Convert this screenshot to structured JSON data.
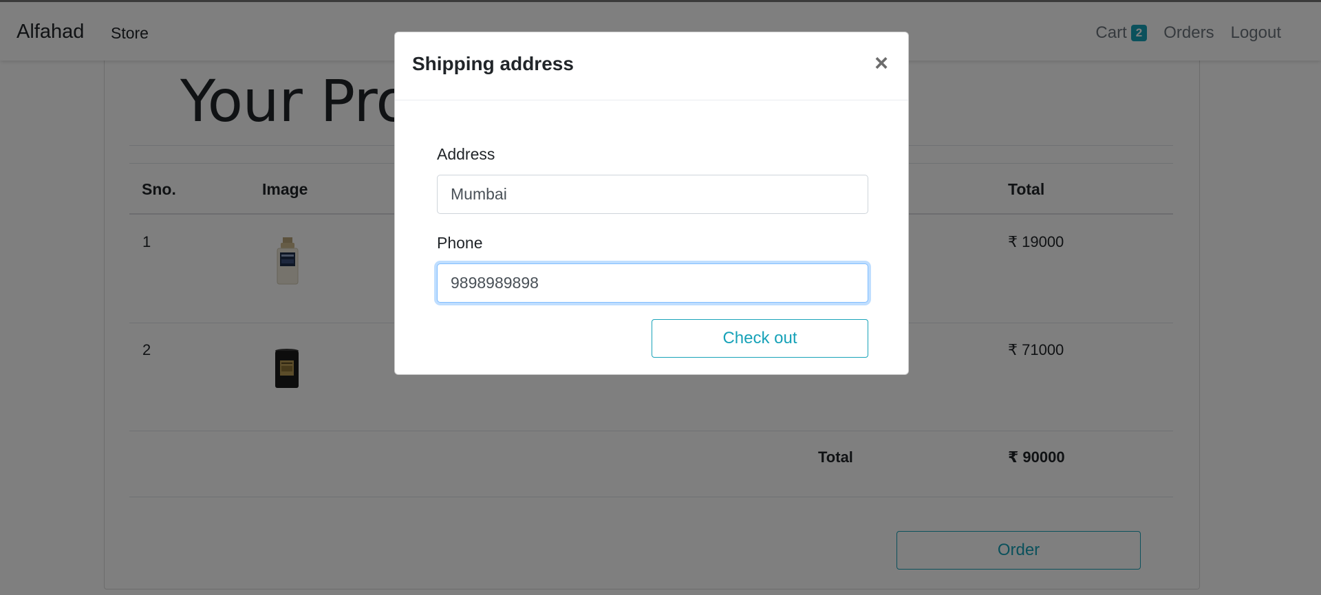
{
  "navbar": {
    "brand": "Alfahad",
    "store_label": "Store",
    "cart_label": "Cart",
    "cart_count": "2",
    "orders_label": "Orders",
    "logout_label": "Logout"
  },
  "page": {
    "title": "Your Products",
    "table": {
      "headers": [
        "Sno.",
        "Image",
        "Total"
      ],
      "rows": [
        {
          "sno": "1",
          "image": "perfume-bottle",
          "total": "₹ 19000"
        },
        {
          "sno": "2",
          "image": "candle-jar",
          "total": "₹ 71000"
        }
      ],
      "footer_label": "Total",
      "footer_total": "₹ 90000"
    },
    "order_label": "Order"
  },
  "modal": {
    "title": "Shipping address",
    "close_icon": "close-icon",
    "address_label": "Address",
    "address_value": "Mumbai",
    "phone_label": "Phone",
    "phone_value": "9898989898",
    "checkout_label": "Check out"
  },
  "colors": {
    "accent": "#17a2b8",
    "focus": "#80bdff",
    "backdrop": "rgba(0,0,0,0.5)"
  }
}
